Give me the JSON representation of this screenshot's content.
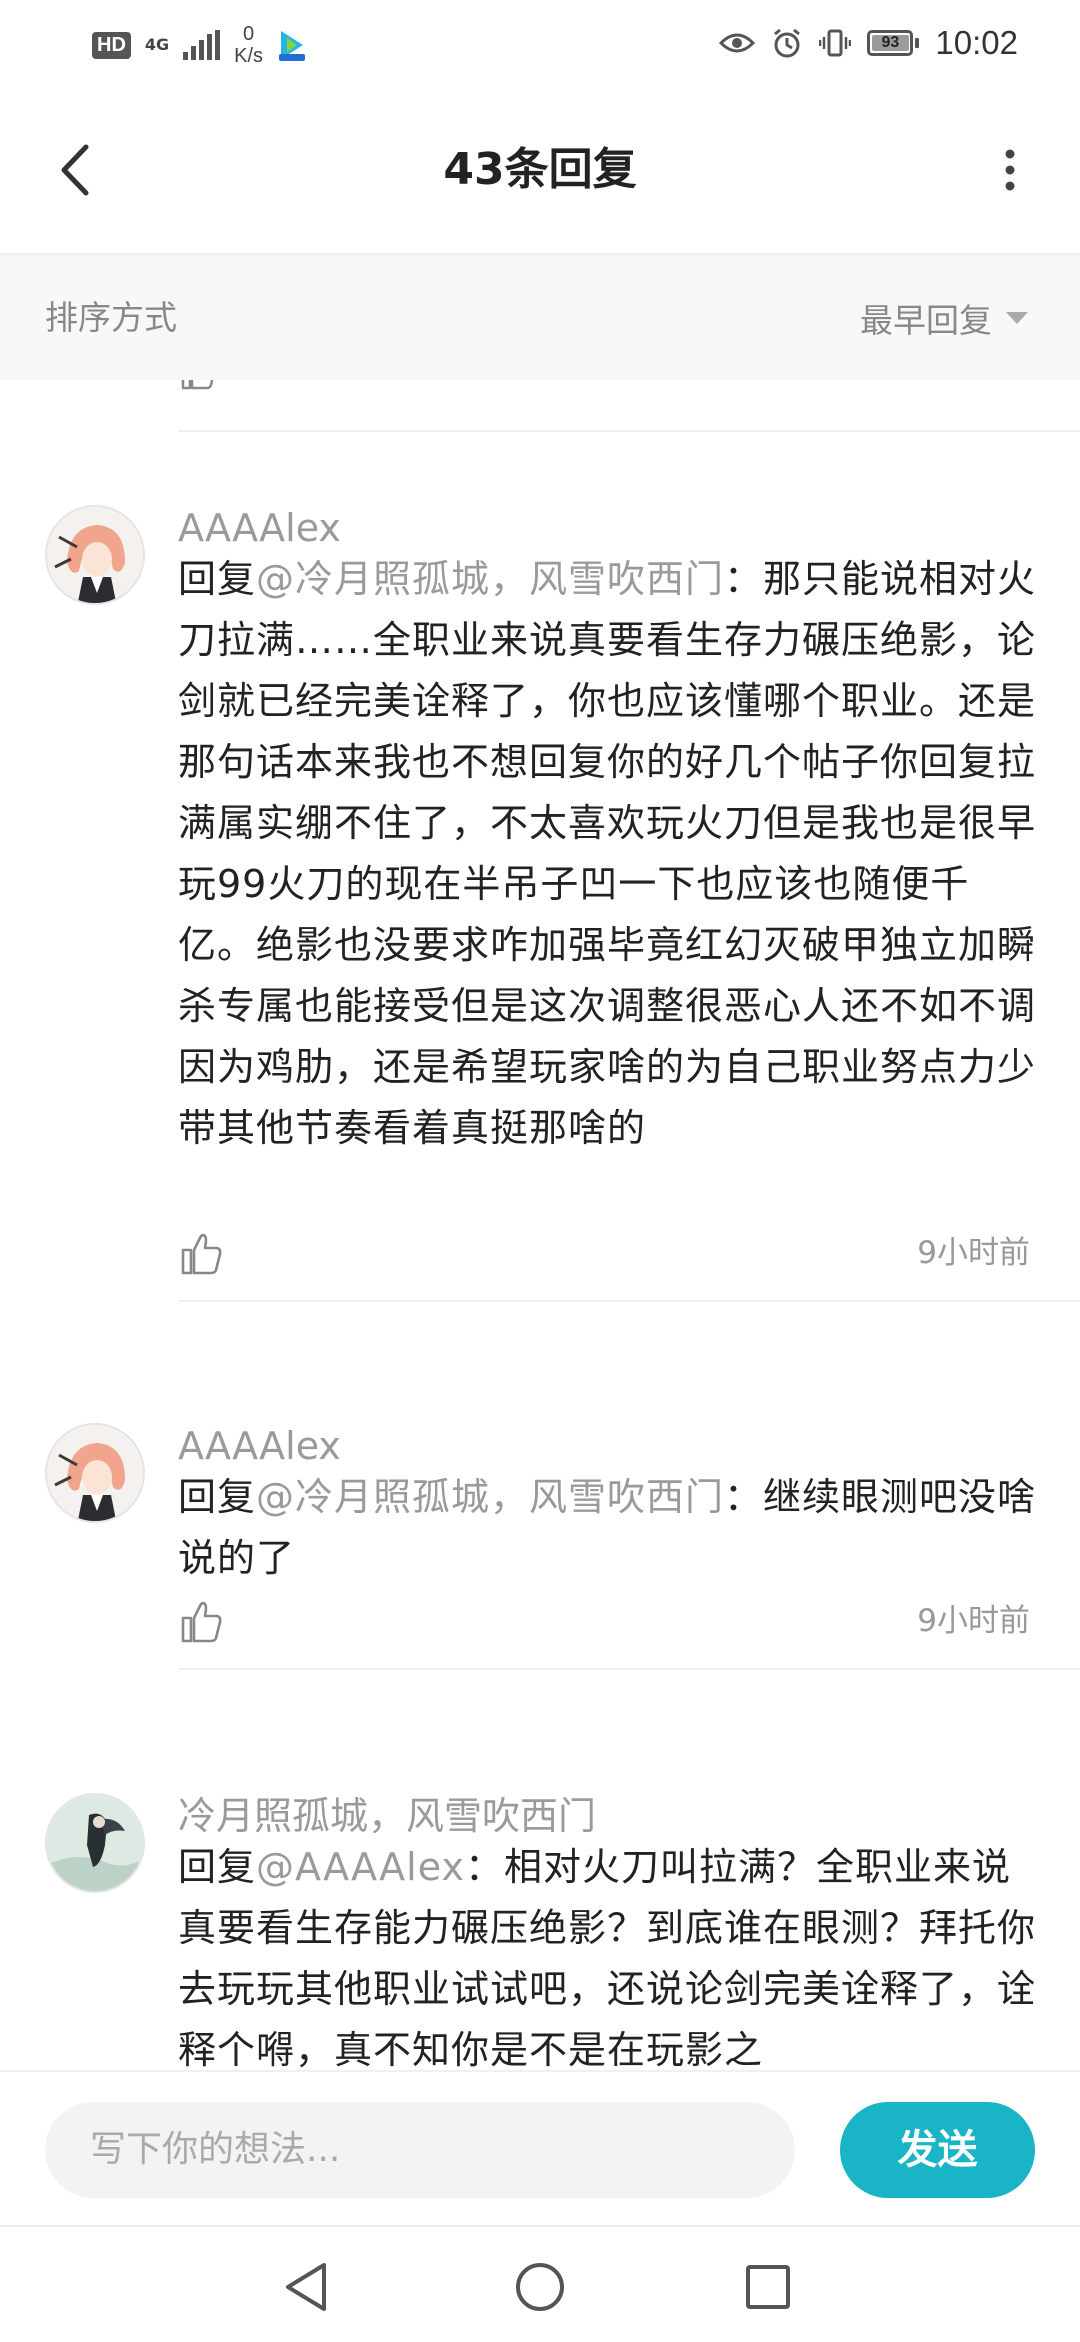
{
  "status_bar": {
    "hd": "HD",
    "network": "4G",
    "speed_value": "0",
    "speed_unit": "K/s",
    "battery": "93",
    "time": "10:02"
  },
  "header": {
    "title": "43条回复"
  },
  "sort": {
    "label": "排序方式",
    "selected": "最早回复"
  },
  "comments": [
    {
      "author": "AAAAlex",
      "mention": "@冷月照孤城，风雪吹西门",
      "reply_prefix": "回复",
      "text": "：那只能说相对火刀拉满……全职业来说真要看生存力碾压绝影，论剑就已经完美诠释了，你也应该懂哪个职业。还是那句话本来我也不想回复你的好几个帖子你回复拉满属实绷不住了，不太喜欢玩火刀但是我也是很早玩99火刀的现在半吊子凹一下也应该也随便千亿。绝影也没要求咋加强毕竟红幻灭破甲独立加瞬杀专属也能接受但是这次调整很恶心人还不如不调因为鸡肋，还是希望玩家啥的为自己职业努点力少带其他节奏看着真挺那啥的",
      "time": "9小时前"
    },
    {
      "author": "AAAAlex",
      "mention": "@冷月照孤城，风雪吹西门",
      "reply_prefix": "回复",
      "text": "：继续眼测吧没啥说的了",
      "time": "9小时前"
    },
    {
      "author": "冷月照孤城，风雪吹西门",
      "mention": "@AAAAlex",
      "reply_prefix": "回复",
      "text": "：相对火刀叫拉满？全职业来说真要看生存能力碾压绝影？到底谁在眼测？拜托你去玩玩其他职业试试吧，还说论剑完美诠释了，诠释个嘚，真不知你是不是在玩影之"
    }
  ],
  "input": {
    "placeholder": "写下你的想法...",
    "send_label": "发送"
  },
  "colors": {
    "accent": "#19b5c6",
    "muted_text": "#9a9a9a",
    "body_text": "#222222"
  },
  "icons": [
    "back-arrow-icon",
    "more-vertical-icon",
    "dropdown-triangle-icon",
    "thumbs-up-icon",
    "nav-back-icon",
    "nav-home-icon",
    "nav-recents-icon"
  ]
}
